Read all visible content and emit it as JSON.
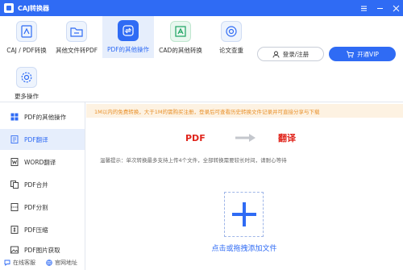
{
  "app": {
    "title": "CAJ转换器"
  },
  "toolbar": {
    "tools": [
      {
        "label": "CAJ / PDF转换"
      },
      {
        "label": "其他文件转PDF"
      },
      {
        "label": "PDF的其他操作"
      },
      {
        "label": "CAD的其他转换"
      },
      {
        "label": "论文查重"
      },
      {
        "label": "更多操作"
      }
    ],
    "login_label": "登录/注册",
    "vip_label": "开通VIP"
  },
  "sidebar": {
    "items": [
      {
        "label": "PDF的其他操作"
      },
      {
        "label": "PDF翻译"
      },
      {
        "label": "WORD翻译"
      },
      {
        "label": "PDF合并"
      },
      {
        "label": "PDF分割"
      },
      {
        "label": "PDF压缩"
      },
      {
        "label": "PDF图片获取"
      }
    ],
    "footer": {
      "service": "在线客服",
      "website": "官网地址"
    }
  },
  "main": {
    "notice": "1M以内的免费转换，大于1M的需购买注册，登录后可查看历史转换文件记录并可直接分享与下载",
    "conversion": {
      "from": "PDF",
      "to": "翻译"
    },
    "hint": "温馨提示：单次转换最多支持上传4个文件，全部转换需要较长时间，请耐心等待",
    "drop_label": "点击或拖拽添加文件"
  },
  "colors": {
    "brand_blue": "#2f6bf4",
    "accent_red": "#e0241b",
    "notice_orange": "#e8902a"
  }
}
